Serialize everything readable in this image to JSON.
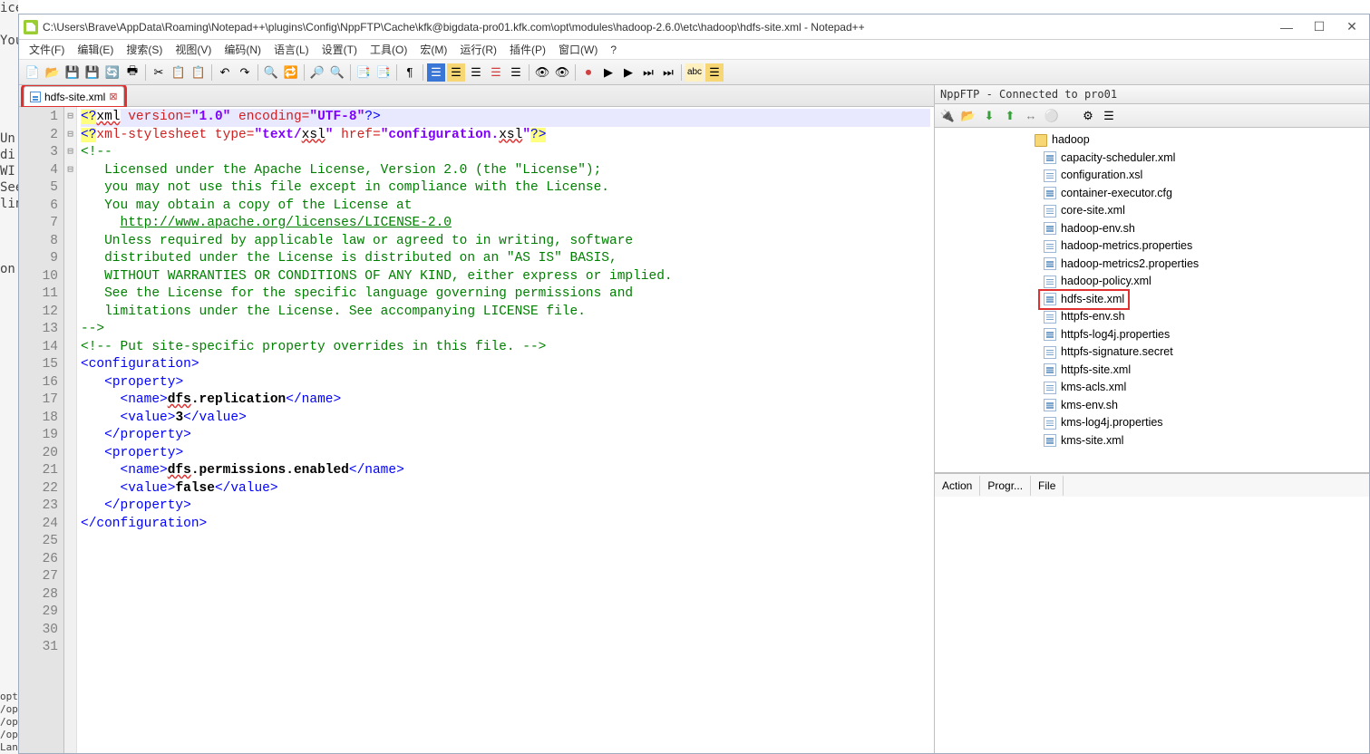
{
  "left_hint_lines": "icensed under the A\n\nYou\n\n\n\n\n\nUn.\ndi:\nWI'\nSee\nlin\n\n\n\non:\n\n",
  "left_bottom": "opt/\n/op\n/op\n/op\nLang",
  "title": "C:\\Users\\Brave\\AppData\\Roaming\\Notepad++\\plugins\\Config\\NppFTP\\Cache\\kfk@bigdata-pro01.kfk.com\\opt\\modules\\hadoop-2.6.0\\etc\\hadoop\\hdfs-site.xml - Notepad++",
  "menus": [
    "文件(F)",
    "编辑(E)",
    "搜索(S)",
    "视图(V)",
    "编码(N)",
    "语言(L)",
    "设置(T)",
    "工具(O)",
    "宏(M)",
    "运行(R)",
    "插件(P)",
    "窗口(W)",
    "?"
  ],
  "tab": {
    "name": "hdfs-site.xml"
  },
  "line_count": 31,
  "fold_marks": {
    "1": "",
    "2": "",
    "3": "⊟",
    "19": "⊟",
    "20": "⊟",
    "25": "⊟"
  },
  "code": {
    "l1_a": "<?",
    "l1_b": "xml",
    "l1_c": " version=",
    "l1_d": "\"1.0\"",
    "l1_e": " encoding=",
    "l1_f": "\"UTF-8\"",
    "l1_g": "?>",
    "l2_a": "<?",
    "l2_b": "xml-stylesheet type=",
    "l2_c": "\"text/",
    "l2_d": "xsl",
    "l2_e": "\"",
    "l2_f": " href=",
    "l2_g": "\"configuration.",
    "l2_h": "xsl",
    "l2_i": "\"",
    "l2_j": "?>",
    "l3": "<!--",
    "l4": "   Licensed under the Apache License, Version 2.0 (the \"License\");",
    "l5": "   you may not use this file except in compliance with the License.",
    "l6": "   You may obtain a copy of the License at",
    "l7": "",
    "l8_pre": "     ",
    "l8_link": "http://www.apache.org/licenses/LICENSE-2.0",
    "l9": "",
    "l10": "   Unless required by applicable law or agreed to in writing, software",
    "l11": "   distributed under the License is distributed on an \"AS IS\" BASIS,",
    "l12": "   WITHOUT WARRANTIES OR CONDITIONS OF ANY KIND, either express or implied.",
    "l13": "   See the License for the specific language governing permissions and",
    "l14": "   limitations under the License. See accompanying LICENSE file.",
    "l15": "-->",
    "l16": "",
    "l17": "<!-- Put site-specific property overrides in this file. -->",
    "l18": "",
    "l19_a": "<",
    "l19_b": "configuration",
    "l19_c": ">",
    "l20_a": "   <",
    "l20_b": "property",
    "l20_c": ">",
    "l21_a": "     <",
    "l21_b": "name",
    "l21_c": ">",
    "l21_d": "dfs",
    "l21_e": ".replication",
    "l21_f": "</",
    "l21_g": "name",
    "l21_h": ">",
    "l22_a": "     <",
    "l22_b": "value",
    "l22_c": ">",
    "l22_d": "3",
    "l22_e": "</",
    "l22_f": "value",
    "l22_g": ">",
    "l23_a": "   </",
    "l23_b": "property",
    "l23_c": ">",
    "l24": "",
    "l25_a": "   <",
    "l25_b": "property",
    "l25_c": ">",
    "l26_a": "     <",
    "l26_b": "name",
    "l26_c": ">",
    "l26_d": "dfs",
    "l26_e": ".permissions.enabled",
    "l26_f": "</",
    "l26_g": "name",
    "l26_h": ">",
    "l27_a": "     <",
    "l27_b": "value",
    "l27_c": ">",
    "l27_d": "false",
    "l27_e": "</",
    "l27_f": "value",
    "l27_g": ">",
    "l28_a": "   </",
    "l28_b": "property",
    "l28_c": ">",
    "l29": "",
    "l30_a": "</",
    "l30_b": "configuration",
    "l30_c": ">",
    "l31": ""
  },
  "ftp": {
    "title": "NppFTP - Connected to pro01",
    "folder": "hadoop",
    "files": [
      "capacity-scheduler.xml",
      "configuration.xsl",
      "container-executor.cfg",
      "core-site.xml",
      "hadoop-env.sh",
      "hadoop-metrics.properties",
      "hadoop-metrics2.properties",
      "hadoop-policy.xml",
      "hdfs-site.xml",
      "httpfs-env.sh",
      "httpfs-log4j.properties",
      "httpfs-signature.secret",
      "httpfs-site.xml",
      "kms-acls.xml",
      "kms-env.sh",
      "kms-log4j.properties",
      "kms-site.xml"
    ],
    "highlighted_index": 8,
    "tabs": [
      "Action",
      "Progr...",
      "File"
    ]
  },
  "toolbar_icons": [
    "📄",
    "📂",
    "💾",
    "💾",
    "🔄",
    "🖶",
    "",
    "✂",
    "📋",
    "📋",
    "",
    "↶",
    "↷",
    "",
    "🔍",
    "🔁",
    "",
    "🔎",
    "🔍",
    "",
    "📑",
    "📑",
    "",
    "¶",
    "",
    "☰",
    "☰",
    "☰",
    "☰",
    "☰",
    "",
    "👁",
    "👁",
    "",
    "⏺",
    "▶",
    "▶",
    "⏭",
    "⏭",
    "",
    "abc",
    "☰"
  ],
  "ftp_toolbar_icons": [
    "🔌",
    "📂",
    "⬇",
    "⬆",
    "↔",
    "⚪",
    "",
    "⚙",
    "☰"
  ]
}
